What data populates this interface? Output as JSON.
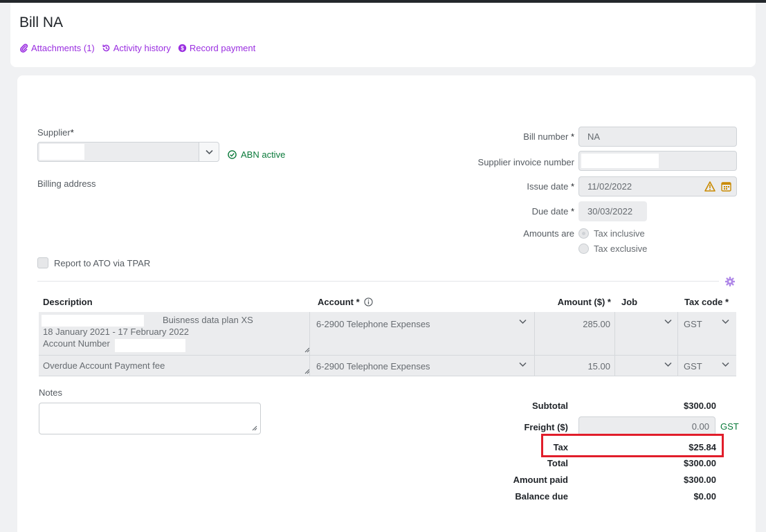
{
  "page": {
    "title": "Bill NA",
    "links": {
      "attachments": "Attachments (1)",
      "activity": "Activity history",
      "record_payment": "Record payment"
    }
  },
  "supplier": {
    "label": "Supplier",
    "required_mark": "*",
    "abn_status": "ABN active"
  },
  "billing_address_label": "Billing address",
  "bill_number": {
    "label": "Bill number",
    "value": "NA"
  },
  "supplier_invoice_number": {
    "label": "Supplier invoice number",
    "value": ""
  },
  "issue_date": {
    "label": "Issue date",
    "value": "11/02/2022"
  },
  "due_date": {
    "label": "Due date",
    "value": "30/03/2022"
  },
  "amounts_are": {
    "label": "Amounts are",
    "options": [
      "Tax inclusive",
      "Tax exclusive"
    ],
    "selected": "Tax inclusive"
  },
  "tpar_label": "Report to ATO via TPAR",
  "table": {
    "headers": {
      "description": "Description",
      "account": "Account *",
      "amount": "Amount ($) *",
      "job": "Job",
      "tax_code": "Tax code *"
    },
    "rows": [
      {
        "description_line1": "Buisness data plan XS",
        "description_line2": "18 January 2021 - 17 February 2022",
        "description_line3": "Account Number",
        "account": "6-2900  Telephone Expenses",
        "amount": "285.00",
        "job": "",
        "tax_code": "GST"
      },
      {
        "description_line1": "Overdue Account Payment fee",
        "account": "6-2900  Telephone Expenses",
        "amount": "15.00",
        "job": "",
        "tax_code": "GST"
      }
    ]
  },
  "notes_label": "Notes",
  "totals": {
    "subtotal_label": "Subtotal",
    "subtotal": "$300.00",
    "freight_label": "Freight ($)",
    "freight": "0.00",
    "freight_tax": "GST",
    "tax_label": "Tax",
    "tax": "$25.84",
    "total_label": "Total",
    "total": "$300.00",
    "paid_label": "Amount paid",
    "paid": "$300.00",
    "balance_label": "Balance due",
    "balance": "$0.00"
  },
  "colors": {
    "link": "#9a2ee0",
    "success": "#0a7a3a",
    "highlight": "#e11d2a"
  }
}
